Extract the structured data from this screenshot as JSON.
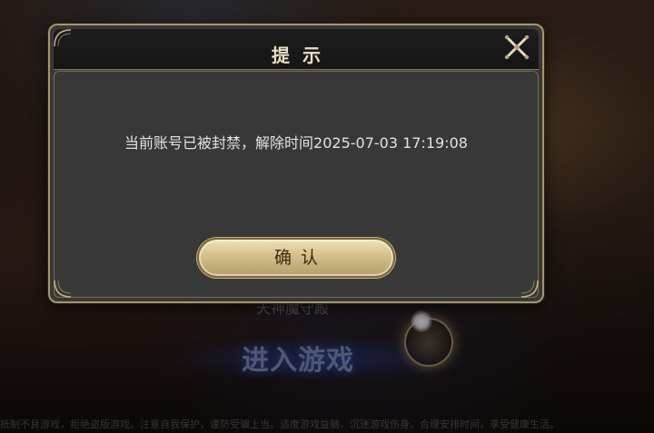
{
  "background": {
    "server_label": "天神魔守殿",
    "enter_game_label": "进入游戏",
    "bottom_notice": "抵制不良游戏，拒绝盗版游戏。注意自我保护，谨防受骗上当。适度游戏益脑，沉迷游戏伤身。合理安排时间，享受健康生活。"
  },
  "dialog": {
    "title": "提示",
    "message": "当前账号已被封禁，解除时间2025-07-03 17:19:08",
    "confirm_label": "确认",
    "close_icon": "close-x-icon"
  },
  "colors": {
    "dialog_bg": "#383838",
    "frame_gold": "#a8946a",
    "button_gold": "#d3bf8c",
    "title_text": "#eadfc5"
  }
}
